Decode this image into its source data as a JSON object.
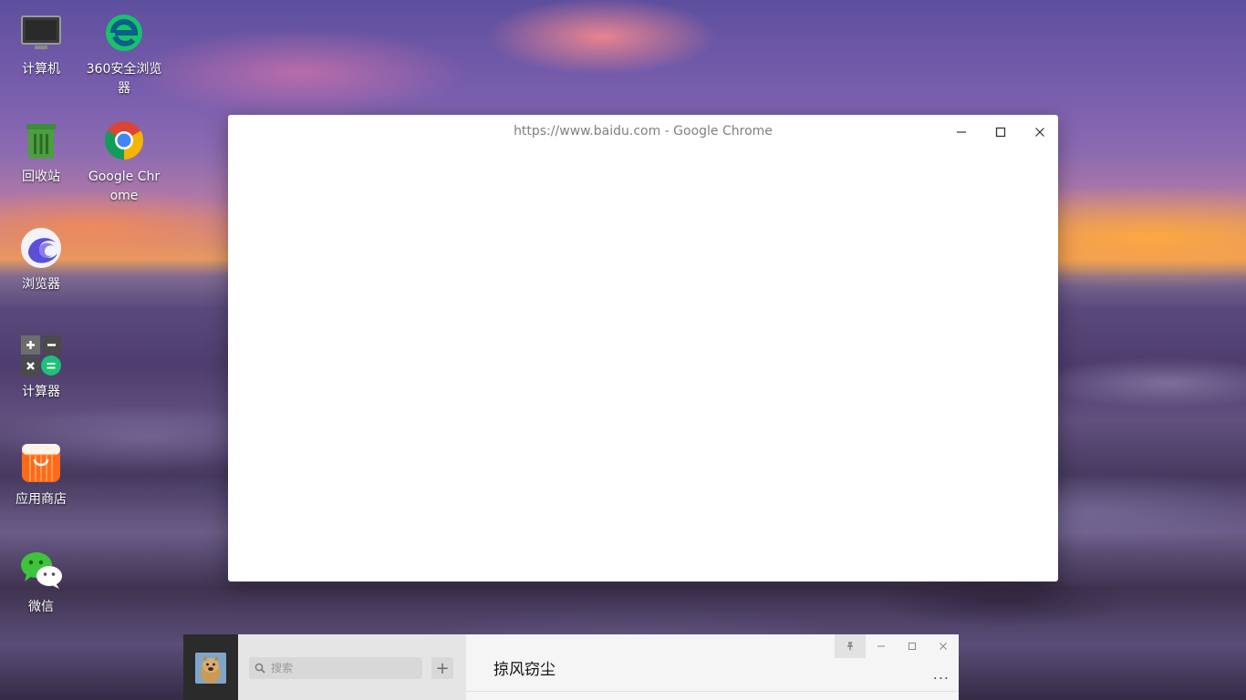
{
  "desktop": {
    "icons": [
      {
        "label": "计算机"
      },
      {
        "label": "360安全浏览器"
      },
      {
        "label": "回收站"
      },
      {
        "label": "Google Chrome"
      },
      {
        "label": "浏览器"
      },
      {
        "label": "计算器"
      },
      {
        "label": "应用商店"
      },
      {
        "label": "微信"
      }
    ]
  },
  "chrome_window": {
    "title": "https://www.baidu.com - Google Chrome"
  },
  "wechat_window": {
    "search_placeholder": "搜索",
    "add_label": "+",
    "chat_title": "掠风窃尘",
    "more_label": "..."
  },
  "colors": {
    "chrome_title": "#808080",
    "wechat_sidebar": "#2b2b2b",
    "wechat_list": "#e6e5e5",
    "wechat_main": "#f5f5f5",
    "chrome_blue": "#4285f4",
    "chrome_red": "#db4437",
    "chrome_yellow": "#f4b400",
    "chrome_green": "#0f9d58"
  }
}
